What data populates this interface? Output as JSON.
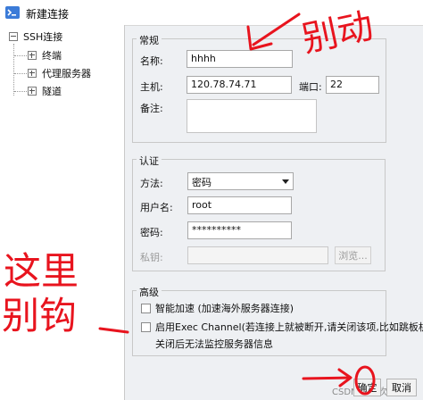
{
  "window": {
    "title": "新建连接"
  },
  "tree": {
    "root": "SSH连接",
    "children": [
      "终端",
      "代理服务器",
      "隧道"
    ]
  },
  "general": {
    "title": "常规",
    "name_label": "名称:",
    "name_value": "hhhh",
    "host_label": "主机:",
    "host_value": "120.78.74.71",
    "port_label": "端口:",
    "port_value": "22",
    "note_label": "备注:",
    "note_value": ""
  },
  "auth": {
    "title": "认证",
    "method_label": "方法:",
    "method_value": "密码",
    "username_label": "用户名:",
    "username_value": "root",
    "password_label": "密码:",
    "password_value": "**********",
    "key_label": "私钥:",
    "key_value": "",
    "browse_label": "浏览..."
  },
  "advanced": {
    "title": "高级",
    "accel_label": "智能加速 (加速海外服务器连接)",
    "exec_label": "启用Exec Channel(若连接上就被断开,请关闭该项,比如跳板机)",
    "exec_note": "关闭后无法监控服务器信息"
  },
  "footer": {
    "ok_label": "确定",
    "cancel_label": "取消",
    "watermark": "CSDN @风吹雨"
  },
  "annotations": {
    "top_right": "别动",
    "left_1": "这里",
    "left_2": "别钩",
    "ink_color": "#e8141e"
  }
}
